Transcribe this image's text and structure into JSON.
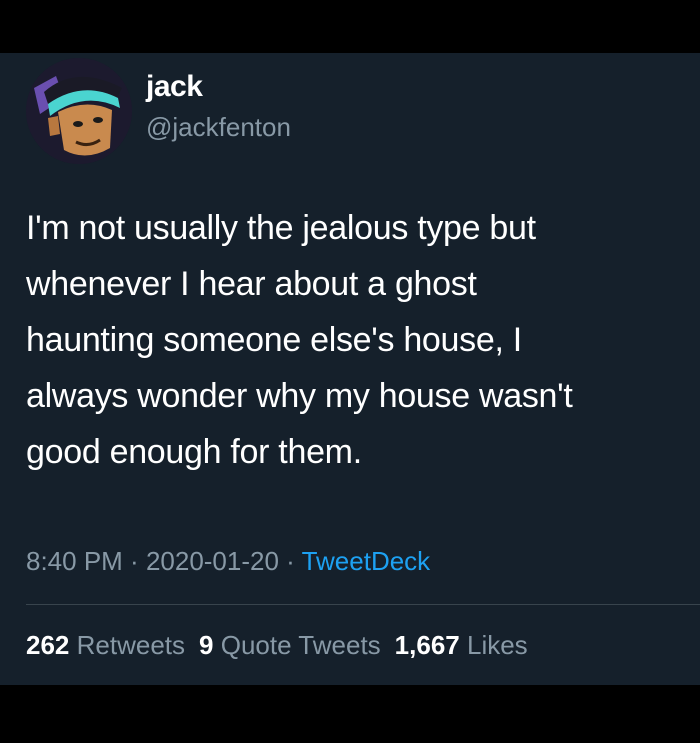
{
  "user": {
    "display_name": "jack",
    "handle": "@jackfenton",
    "avatar_icon": "cartoon-avatar-icon"
  },
  "tweet": {
    "text": "I'm not usually the jealous type but\nwhenever I hear about a ghost\nhaunting someone else's house, I\nalways wonder why my house wasn't\ngood enough for them.",
    "time": "8:40 PM",
    "separator": " · ",
    "date": "2020-01-20",
    "source": "TweetDeck"
  },
  "stats": {
    "retweets_count": "262",
    "retweets_label": "Retweets",
    "quotes_count": "9",
    "quotes_label": "Quote Tweets",
    "likes_count": "1,667",
    "likes_label": "Likes"
  },
  "colors": {
    "background": "#15202b",
    "text": "#ffffff",
    "muted": "#8899a6",
    "link": "#1da1f2"
  }
}
